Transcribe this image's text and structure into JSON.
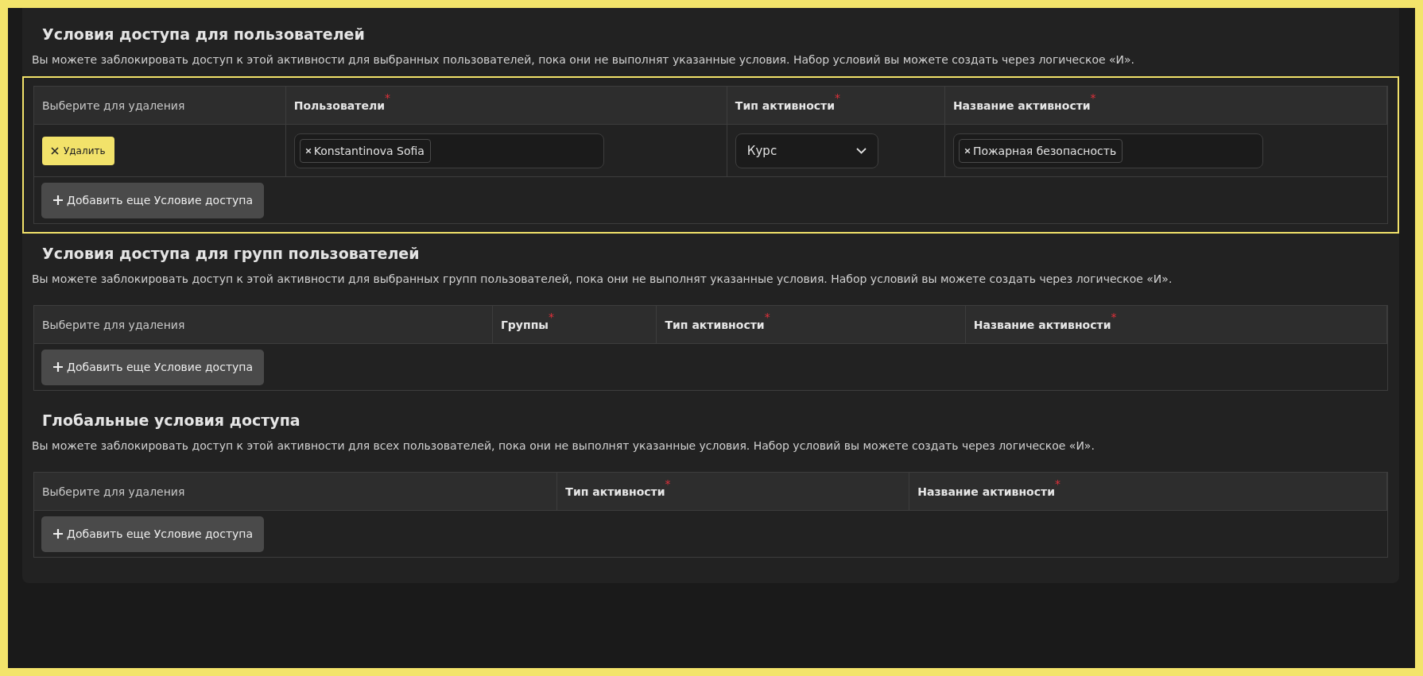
{
  "sections": [
    {
      "title": "Условия доступа для пользователей",
      "description": "Вы можете заблокировать доступ к этой активности для выбранных пользователей, пока они не выполнят указанные условия. Набор условий вы можете создать через логическое «И».",
      "highlighted": true,
      "columns": [
        {
          "label": "Выберите для удаления"
        },
        {
          "label": "Пользователи",
          "required_mark": "*"
        },
        {
          "label": "Тип активности",
          "required_mark": "*"
        },
        {
          "label": "Название активности",
          "required_mark": "*"
        }
      ],
      "rows": [
        {
          "cells": [
            {
              "kind": "delete",
              "label": "Удалить"
            },
            {
              "kind": "tags",
              "tags": [
                "Konstantinova Sofia"
              ]
            },
            {
              "kind": "select",
              "value": "Курс"
            },
            {
              "kind": "tags",
              "tags": [
                "Пожарная безопасность"
              ]
            }
          ]
        }
      ],
      "add_button": "Добавить еще Условие доступа"
    },
    {
      "title": "Условия доступа для групп пользователей",
      "description": "Вы можете заблокировать доступ к этой активности для выбранных групп пользователей, пока они не выполнят указанные условия. Набор условий вы можете создать через логическое «И».",
      "highlighted": false,
      "columns": [
        {
          "label": "Выберите для удаления"
        },
        {
          "label": "Группы",
          "required_mark": "*"
        },
        {
          "label": "Тип активности",
          "required_mark": "*"
        },
        {
          "label": "Название активности",
          "required_mark": "*"
        }
      ],
      "add_button": "Добавить еще Условие доступа"
    },
    {
      "title": "Глобальные условия доступа",
      "description": "Вы можете заблокировать доступ к этой активности для всех пользователей, пока они не выполнят указанные условия. Набор условий вы можете создать через логическое «И».",
      "highlighted": false,
      "columns": [
        {
          "label": "Выберите для удаления"
        },
        {
          "label": "Тип активности",
          "required_mark": "*"
        },
        {
          "label": "Название активности",
          "required_mark": "*"
        }
      ],
      "add_button": "Добавить еще Условие доступа"
    }
  ]
}
